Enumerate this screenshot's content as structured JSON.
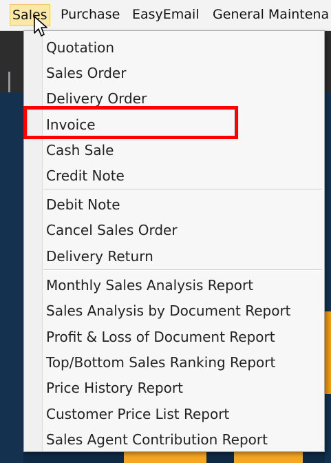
{
  "menubar": {
    "items": [
      {
        "label": "Sales",
        "active": true
      },
      {
        "label": "Purchase",
        "active": false
      },
      {
        "label": "EasyEmail",
        "active": false
      },
      {
        "label": "General Maintena",
        "active": false
      }
    ]
  },
  "dropdown": {
    "items": [
      {
        "label": "Quotation"
      },
      {
        "label": "Sales Order"
      },
      {
        "label": "Delivery Order"
      },
      {
        "label": "Invoice",
        "highlighted": true
      },
      {
        "label": "Cash Sale"
      },
      {
        "label": "Credit Note"
      },
      {
        "label": "Debit Note"
      },
      {
        "label": "Cancel Sales Order"
      },
      {
        "label": "Delivery Return"
      },
      {
        "label": "Monthly Sales Analysis Report"
      },
      {
        "label": "Sales Analysis by Document Report"
      },
      {
        "label": "Profit & Loss of Document Report"
      },
      {
        "label": "Top/Bottom Sales Ranking Report"
      },
      {
        "label": "Price History Report"
      },
      {
        "label": "Customer Price List Report"
      },
      {
        "label": "Sales Agent Contribution Report"
      }
    ]
  },
  "colors": {
    "highlight_border": "#ff0000",
    "active_menu_bg": "#fbe7a6",
    "menu_bg": "#f7f7f7"
  },
  "icons": {
    "cursor": "mouse-pointer-icon"
  }
}
